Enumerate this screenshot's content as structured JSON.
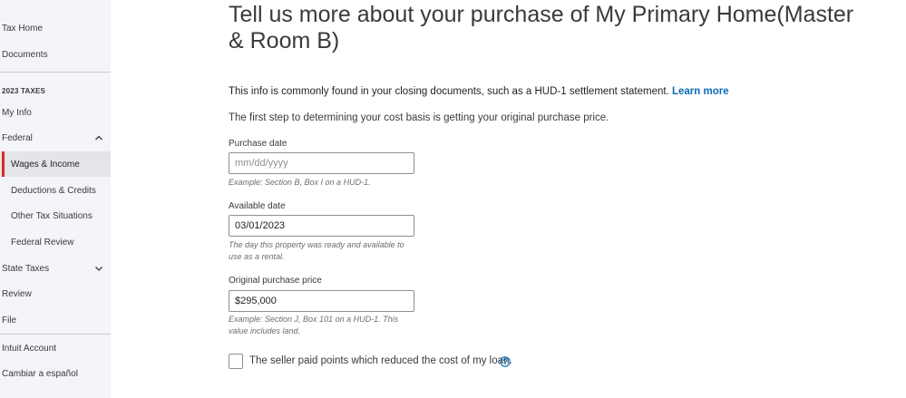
{
  "sidebar": {
    "items_top": [
      {
        "label": "Tax Home"
      },
      {
        "label": "Documents"
      }
    ],
    "section_label": "2023 TAXES",
    "my_info": "My Info",
    "federal": "Federal",
    "federal_sub": [
      {
        "label": "Wages & Income",
        "active": true
      },
      {
        "label": "Deductions & Credits"
      },
      {
        "label": "Other Tax Situations"
      },
      {
        "label": "Federal Review"
      }
    ],
    "state_taxes": "State Taxes",
    "review": "Review",
    "file": "File",
    "items_bottom": [
      {
        "label": "Intuit Account"
      },
      {
        "label": "Cambiar a español"
      }
    ]
  },
  "main": {
    "title": "Tell us more about your purchase of My Primary Home(Master & Room B)",
    "info_text": "This info is commonly found in your closing documents, such as a HUD-1 settlement statement.",
    "learn_more": "Learn more",
    "intro": "The first step to determining your cost basis is getting your original purchase price.",
    "purchase_date": {
      "label": "Purchase date",
      "value": "",
      "placeholder": "mm/dd/yyyy",
      "hint": "Example: Section B, Box I on a HUD-1."
    },
    "available_date": {
      "label": "Available date",
      "value": "03/01/2023",
      "hint": "The day this property was ready and available to use as a rental."
    },
    "purchase_price": {
      "label": "Original purchase price",
      "value": "$295,000",
      "hint": "Example: Section J, Box 101 on a HUD-1. This value includes land."
    },
    "checkbox_label": "The seller paid points which reduced the cost of my loan.",
    "checkbox_checked": false
  },
  "colors": {
    "active_marker": "#d52b1e",
    "link": "#0d6eb5",
    "sidebar_bg": "#f4f5f8",
    "active_bg": "#e4e5e8"
  },
  "icons": {
    "federal_toggle": "chevron-up-icon",
    "state_toggle": "chevron-down-icon",
    "help": "help-circle-icon"
  }
}
